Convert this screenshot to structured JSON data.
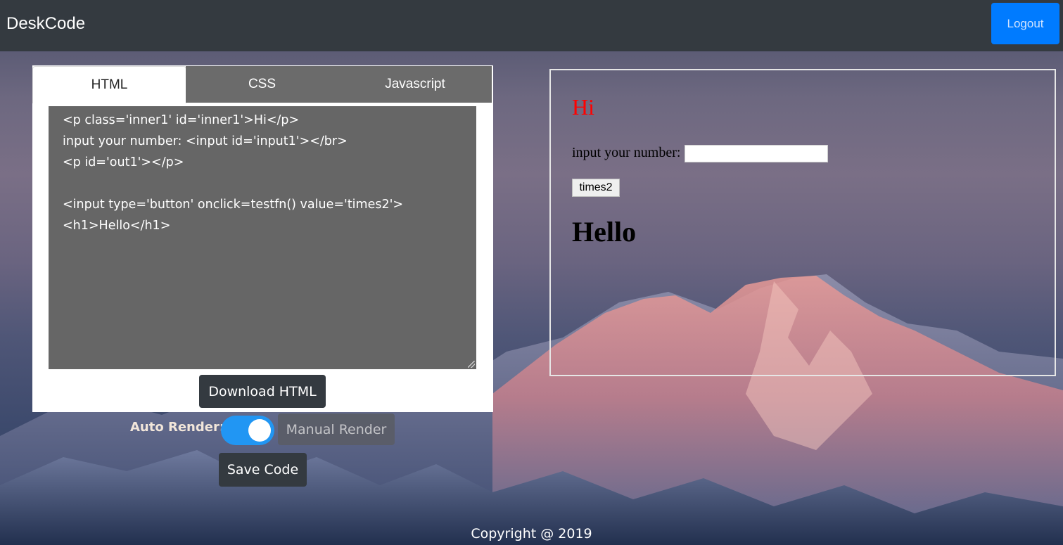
{
  "navbar": {
    "brand": "DeskCode",
    "logout_label": "Logout"
  },
  "editor": {
    "tabs": [
      {
        "label": "HTML",
        "active": true
      },
      {
        "label": "CSS",
        "active": false
      },
      {
        "label": "Javascript",
        "active": false
      }
    ],
    "code": "<p class='inner1' id='inner1'>Hi</p>\ninput your number: <input id='input1'></br>\n<p id='out1'></p>\n\n<input type='button' onclick=testfn() value='times2'>\n<h1>Hello</h1>",
    "download_label": "Download HTML"
  },
  "controls": {
    "auto_render_label": "Auto Render:",
    "auto_render_on": true,
    "manual_render_label": "Manual Render",
    "save_label": "Save Code"
  },
  "preview": {
    "hi_text": "Hi",
    "input_label": "input your number:",
    "input_value": "",
    "button_value": "times2",
    "out1_text": "",
    "heading": "Hello"
  },
  "footer": {
    "copyright": "Copyright @ 2019"
  },
  "colors": {
    "navbar": "#343a40",
    "logout": "#007bff",
    "toggle_on": "#2196f3",
    "code_bg": "#666666",
    "hi_red": "#ff0000"
  }
}
